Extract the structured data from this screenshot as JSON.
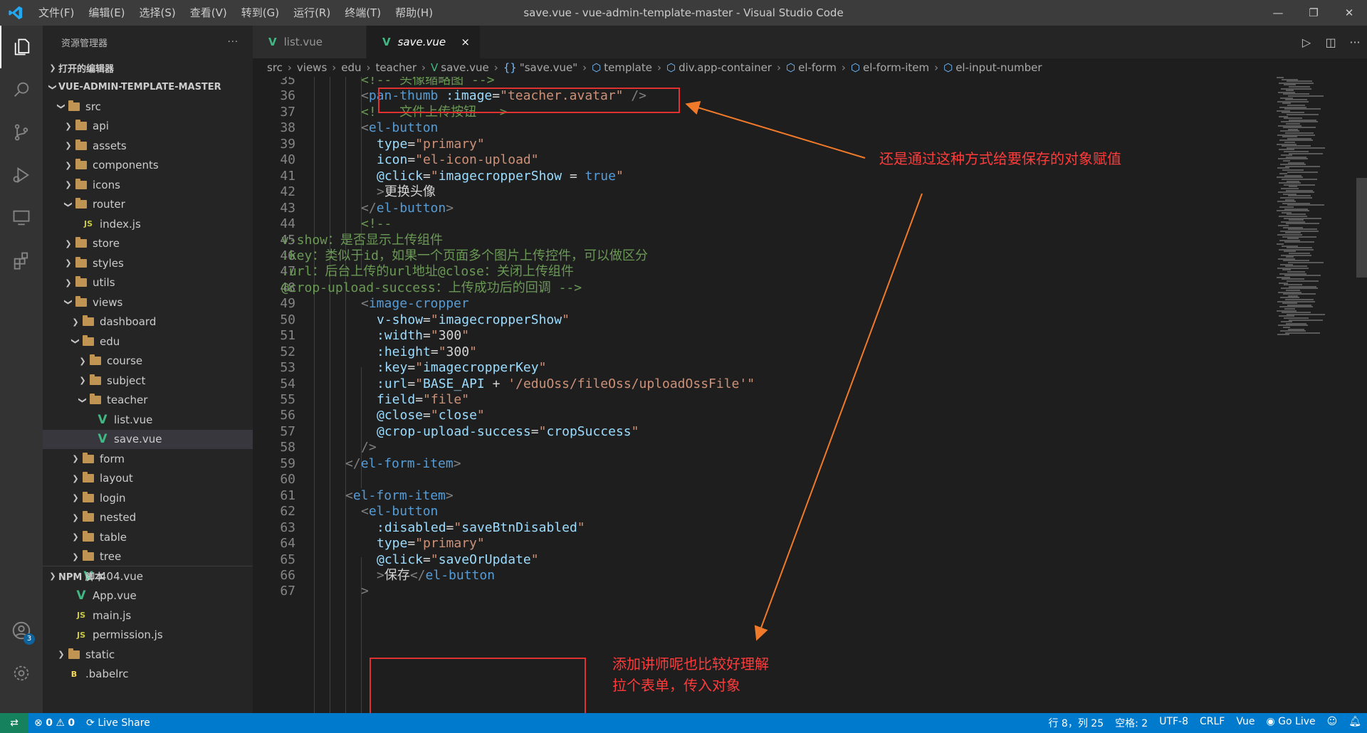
{
  "window": {
    "title": "save.vue - vue-admin-template-master - Visual Studio Code",
    "menu": [
      "文件(F)",
      "编辑(E)",
      "选择(S)",
      "查看(V)",
      "转到(G)",
      "运行(R)",
      "终端(T)",
      "帮助(H)"
    ]
  },
  "activity_bar": {
    "accounts_badge": "3"
  },
  "sidebar": {
    "header": "资源管理器",
    "open_editors": "打开的编辑器",
    "workspace": "VUE-ADMIN-TEMPLATE-MASTER",
    "npm": "NPM 脚本",
    "tree": [
      {
        "label": "src",
        "depth": 0,
        "type": "folder",
        "expanded": true
      },
      {
        "label": "api",
        "depth": 1,
        "type": "folder",
        "expanded": false
      },
      {
        "label": "assets",
        "depth": 1,
        "type": "folder",
        "expanded": false
      },
      {
        "label": "components",
        "depth": 1,
        "type": "folder",
        "expanded": false
      },
      {
        "label": "icons",
        "depth": 1,
        "type": "folder",
        "expanded": false
      },
      {
        "label": "router",
        "depth": 1,
        "type": "folder",
        "expanded": true
      },
      {
        "label": "index.js",
        "depth": 2,
        "type": "js"
      },
      {
        "label": "store",
        "depth": 1,
        "type": "folder",
        "expanded": false
      },
      {
        "label": "styles",
        "depth": 1,
        "type": "folder",
        "expanded": false
      },
      {
        "label": "utils",
        "depth": 1,
        "type": "folder",
        "expanded": false
      },
      {
        "label": "views",
        "depth": 1,
        "type": "folder",
        "expanded": true
      },
      {
        "label": "dashboard",
        "depth": 2,
        "type": "folder",
        "expanded": false
      },
      {
        "label": "edu",
        "depth": 2,
        "type": "folder",
        "expanded": true
      },
      {
        "label": "course",
        "depth": 3,
        "type": "folder",
        "expanded": false
      },
      {
        "label": "subject",
        "depth": 3,
        "type": "folder",
        "expanded": false
      },
      {
        "label": "teacher",
        "depth": 3,
        "type": "folder",
        "expanded": true
      },
      {
        "label": "list.vue",
        "depth": 4,
        "type": "vue"
      },
      {
        "label": "save.vue",
        "depth": 4,
        "type": "vue",
        "selected": true
      },
      {
        "label": "form",
        "depth": 2,
        "type": "folder",
        "expanded": false
      },
      {
        "label": "layout",
        "depth": 2,
        "type": "folder",
        "expanded": false
      },
      {
        "label": "login",
        "depth": 2,
        "type": "folder",
        "expanded": false
      },
      {
        "label": "nested",
        "depth": 2,
        "type": "folder",
        "expanded": false
      },
      {
        "label": "table",
        "depth": 2,
        "type": "folder",
        "expanded": false
      },
      {
        "label": "tree",
        "depth": 2,
        "type": "folder",
        "expanded": false
      },
      {
        "label": "404.vue",
        "depth": 2,
        "type": "vue"
      },
      {
        "label": "App.vue",
        "depth": 1,
        "type": "vue"
      },
      {
        "label": "main.js",
        "depth": 1,
        "type": "js"
      },
      {
        "label": "permission.js",
        "depth": 1,
        "type": "js"
      },
      {
        "label": "static",
        "depth": 0,
        "type": "folder",
        "expanded": false
      },
      {
        "label": ".babelrc",
        "depth": 0,
        "type": "babel"
      }
    ]
  },
  "tabs": [
    {
      "label": "list.vue",
      "active": false
    },
    {
      "label": "save.vue",
      "active": true,
      "close": "×"
    }
  ],
  "breadcrumb": [
    "src",
    "views",
    "edu",
    "teacher",
    "save.vue",
    "\"save.vue\"",
    "template",
    "div.app-container",
    "el-form",
    "el-form-item",
    "el-input-number"
  ],
  "code": [
    {
      "n": "35",
      "indent": 4,
      "tokens": [
        [
          "cm",
          "<!-- 头像缩略图 -->"
        ]
      ]
    },
    {
      "n": "36",
      "indent": 4,
      "tokens": [
        [
          "pu",
          "<"
        ],
        [
          "tg",
          "pan-thumb"
        ],
        [
          "tx",
          " "
        ],
        [
          "at",
          ":image"
        ],
        [
          "tx",
          "="
        ],
        [
          "st",
          "\"teacher.avatar\""
        ],
        [
          "tx",
          " "
        ],
        [
          "pu",
          "/>"
        ]
      ]
    },
    {
      "n": "37",
      "indent": 4,
      "tokens": [
        [
          "cm",
          "<!-- 文件上传按钮 -->"
        ]
      ]
    },
    {
      "n": "38",
      "indent": 4,
      "tokens": [
        [
          "pu",
          "<"
        ],
        [
          "tg",
          "el-button"
        ]
      ]
    },
    {
      "n": "39",
      "indent": 5,
      "tokens": [
        [
          "at",
          "type"
        ],
        [
          "tx",
          "="
        ],
        [
          "st",
          "\"primary\""
        ]
      ]
    },
    {
      "n": "40",
      "indent": 5,
      "tokens": [
        [
          "at",
          "icon"
        ],
        [
          "tx",
          "="
        ],
        [
          "st",
          "\"el-icon-upload\""
        ]
      ]
    },
    {
      "n": "41",
      "indent": 5,
      "tokens": [
        [
          "at",
          "@click"
        ],
        [
          "tx",
          "="
        ],
        [
          "st",
          "\""
        ],
        [
          "at",
          "imagecropperShow"
        ],
        [
          "tx",
          " = "
        ],
        [
          "kw",
          "true"
        ],
        [
          "st",
          "\""
        ]
      ]
    },
    {
      "n": "42",
      "indent": 5,
      "tokens": [
        [
          "pu",
          ">"
        ],
        [
          "tx",
          "更换头像"
        ]
      ]
    },
    {
      "n": "43",
      "indent": 4,
      "tokens": [
        [
          "pu",
          "</"
        ],
        [
          "tg",
          "el-button"
        ],
        [
          "pu",
          ">"
        ]
      ]
    },
    {
      "n": "44",
      "indent": 4,
      "tokens": [
        [
          "cm",
          "<!--"
        ]
      ]
    },
    {
      "n": "45",
      "indent": 0,
      "tokens": [
        [
          "cm",
          "v-show：是否显示上传组件"
        ]
      ]
    },
    {
      "n": "46",
      "indent": 0,
      "tokens": [
        [
          "cm",
          ":key：类似于id，如果一个页面多个图片上传控件，可以做区分"
        ]
      ]
    },
    {
      "n": "47",
      "indent": 0,
      "tokens": [
        [
          "cm",
          ":url：后台上传的url地址@close：关闭上传组件"
        ]
      ]
    },
    {
      "n": "48",
      "indent": 0,
      "tokens": [
        [
          "cm",
          "@crop-upload-success：上传成功后的回调 -->"
        ]
      ]
    },
    {
      "n": "49",
      "indent": 4,
      "tokens": [
        [
          "pu",
          "<"
        ],
        [
          "tg",
          "image-cropper"
        ]
      ]
    },
    {
      "n": "50",
      "indent": 5,
      "tokens": [
        [
          "at",
          "v-show"
        ],
        [
          "tx",
          "="
        ],
        [
          "st",
          "\""
        ],
        [
          "at",
          "imagecropperShow"
        ],
        [
          "st",
          "\""
        ]
      ]
    },
    {
      "n": "51",
      "indent": 5,
      "tokens": [
        [
          "at",
          ":width"
        ],
        [
          "tx",
          "="
        ],
        [
          "st",
          "\""
        ],
        [
          "tx",
          "300"
        ],
        [
          "st",
          "\""
        ]
      ]
    },
    {
      "n": "52",
      "indent": 5,
      "tokens": [
        [
          "at",
          ":height"
        ],
        [
          "tx",
          "="
        ],
        [
          "st",
          "\""
        ],
        [
          "tx",
          "300"
        ],
        [
          "st",
          "\""
        ]
      ]
    },
    {
      "n": "53",
      "indent": 5,
      "tokens": [
        [
          "at",
          ":key"
        ],
        [
          "tx",
          "="
        ],
        [
          "st",
          "\""
        ],
        [
          "at",
          "imagecropperKey"
        ],
        [
          "st",
          "\""
        ]
      ]
    },
    {
      "n": "54",
      "indent": 5,
      "tokens": [
        [
          "at",
          ":url"
        ],
        [
          "tx",
          "="
        ],
        [
          "st",
          "\""
        ],
        [
          "at",
          "BASE_API"
        ],
        [
          "tx",
          " + "
        ],
        [
          "st",
          "'/eduOss/fileOss/uploadOssFile'"
        ],
        [
          "st",
          "\""
        ]
      ]
    },
    {
      "n": "55",
      "indent": 5,
      "tokens": [
        [
          "at",
          "field"
        ],
        [
          "tx",
          "="
        ],
        [
          "st",
          "\"file\""
        ]
      ]
    },
    {
      "n": "56",
      "indent": 5,
      "tokens": [
        [
          "at",
          "@close"
        ],
        [
          "tx",
          "="
        ],
        [
          "st",
          "\""
        ],
        [
          "at",
          "close"
        ],
        [
          "st",
          "\""
        ]
      ]
    },
    {
      "n": "57",
      "indent": 5,
      "tokens": [
        [
          "at",
          "@crop-upload-success"
        ],
        [
          "tx",
          "="
        ],
        [
          "st",
          "\""
        ],
        [
          "at",
          "cropSuccess"
        ],
        [
          "st",
          "\""
        ]
      ]
    },
    {
      "n": "58",
      "indent": 4,
      "tokens": [
        [
          "pu",
          "/>"
        ]
      ]
    },
    {
      "n": "59",
      "indent": 3,
      "tokens": [
        [
          "pu",
          "</"
        ],
        [
          "tg",
          "el-form-item"
        ],
        [
          "pu",
          ">"
        ]
      ]
    },
    {
      "n": "60",
      "indent": 0,
      "tokens": []
    },
    {
      "n": "61",
      "indent": 3,
      "tokens": [
        [
          "pu",
          "<"
        ],
        [
          "tg",
          "el-form-item"
        ],
        [
          "pu",
          ">"
        ]
      ]
    },
    {
      "n": "62",
      "indent": 4,
      "tokens": [
        [
          "pu",
          "<"
        ],
        [
          "tg",
          "el-button"
        ]
      ]
    },
    {
      "n": "63",
      "indent": 5,
      "tokens": [
        [
          "at",
          ":disabled"
        ],
        [
          "tx",
          "="
        ],
        [
          "st",
          "\""
        ],
        [
          "at",
          "saveBtnDisabled"
        ],
        [
          "st",
          "\""
        ]
      ]
    },
    {
      "n": "64",
      "indent": 5,
      "tokens": [
        [
          "at",
          "type"
        ],
        [
          "tx",
          "="
        ],
        [
          "st",
          "\"primary\""
        ]
      ]
    },
    {
      "n": "65",
      "indent": 5,
      "tokens": [
        [
          "at",
          "@click"
        ],
        [
          "tx",
          "="
        ],
        [
          "st",
          "\""
        ],
        [
          "at",
          "saveOrUpdate"
        ],
        [
          "st",
          "\""
        ]
      ]
    },
    {
      "n": "66",
      "indent": 5,
      "tokens": [
        [
          "pu",
          ">"
        ],
        [
          "tx",
          "保存"
        ],
        [
          "pu",
          "</"
        ],
        [
          "tg",
          "el-button"
        ]
      ]
    },
    {
      "n": "67",
      "indent": 4,
      "tokens": [
        [
          "pu",
          ">"
        ]
      ]
    }
  ],
  "annotations": {
    "note1": "还是通过这种方式给要保存的对象赋值",
    "note2_line1": "添加讲师呢也比较好理解",
    "note2_line2": "拉个表单，传入对象",
    "color": "#e03030",
    "arrow_color": "#f07a2a"
  },
  "status": {
    "errors": "0",
    "warnings": "0",
    "live_share": "Live Share",
    "position": "行 8，列 25",
    "spaces": "空格: 2",
    "encoding": "UTF-8",
    "eol": "CRLF",
    "language": "Vue",
    "go_live": "Go Live"
  }
}
